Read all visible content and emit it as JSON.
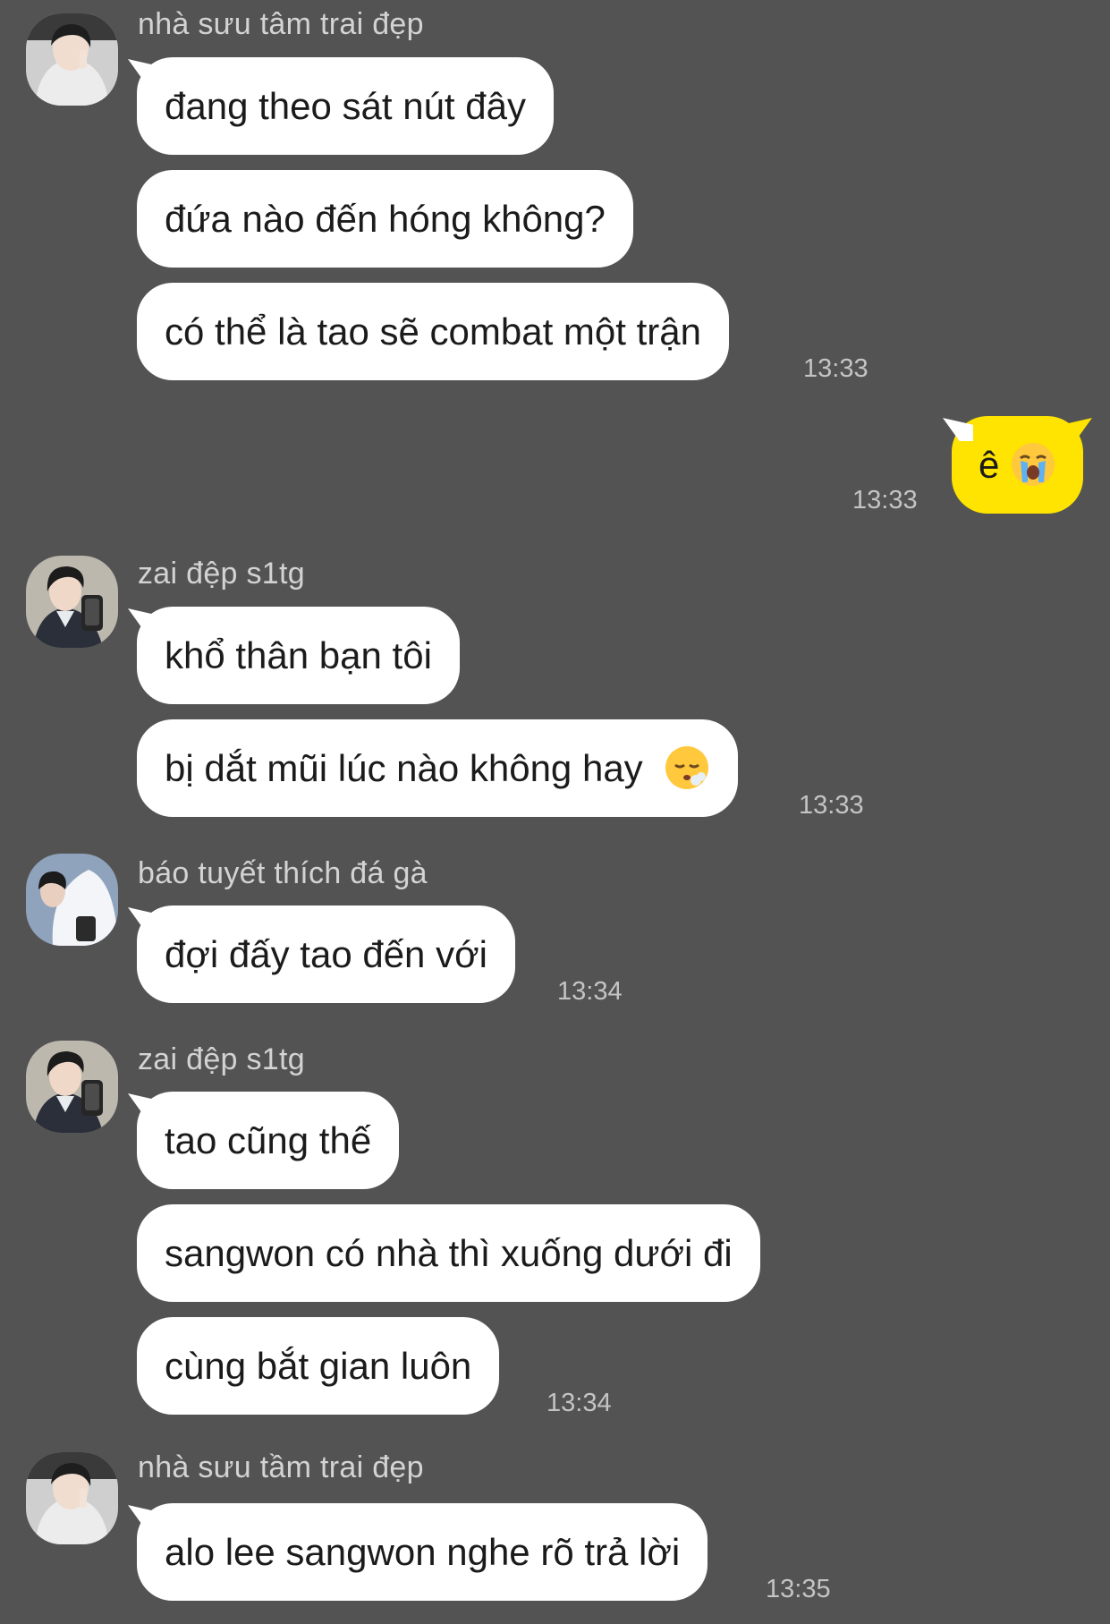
{
  "messages": [
    {
      "sender": "nhà sưu tâm trai đẹp",
      "avatar": "avatar-hoodie-peace-sign",
      "bubbles": [
        "đang theo sát nút đây",
        "đứa nào đến hóng không?",
        "có thể là tao sẽ combat một trận"
      ],
      "time": "13:33"
    },
    {
      "sender": "",
      "is_me": true,
      "bubble_text": "ê",
      "emoji": "loudly-crying-face-emoji",
      "time": "13:33"
    },
    {
      "sender": "zai đệp s1tg",
      "avatar": "avatar-mirror-selfie",
      "bubbles": [
        "khổ thân bạn tôi",
        "bị dắt mũi lúc nào không hay"
      ],
      "emoji": "face-exhaling-emoji",
      "time": "13:33"
    },
    {
      "sender": "báo tuyết thích đá gà",
      "avatar": "avatar-white-shirt",
      "bubbles": [
        "đợi đấy tao đến với"
      ],
      "time": "13:34"
    },
    {
      "sender": "zai đệp s1tg",
      "avatar": "avatar-mirror-selfie",
      "bubbles": [
        "tao cũng thế",
        "sangwon có nhà thì xuống dưới đi",
        "cùng bắt gian luôn"
      ],
      "time": "13:34"
    },
    {
      "sender": "nhà sưu tầm trai đẹp",
      "avatar": "avatar-hoodie-peace-sign",
      "bubbles": [
        "alo lee sangwon nghe rõ trả lời"
      ],
      "time": "13:35"
    }
  ],
  "colors": {
    "background": "#535353",
    "incoming_bubble": "#ffffff",
    "outgoing_bubble": "#fee400",
    "sender_name": "#d3d3d3",
    "timestamp": "#c4c4c4"
  }
}
